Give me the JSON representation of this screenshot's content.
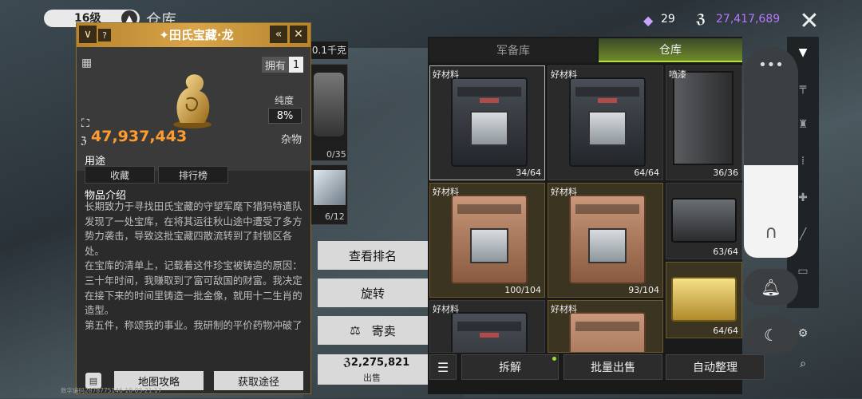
{
  "header": {
    "level": "16级",
    "title": "仓库",
    "gems": "29",
    "money": "27,417,689"
  },
  "detail": {
    "title": "✦田氏宝藏·龙",
    "own_label": "拥有",
    "own_count": "1",
    "purity_label": "纯度",
    "purity_value": "8%",
    "price": "47,937,443",
    "category": "杂物",
    "use_title": "用途",
    "btn_collect": "收藏",
    "btn_rank": "排行榜",
    "intro_title": "物品介绍",
    "description": "长期致力于寻找田氏宝藏的守望军麾下猎犸特遣队发现了一处宝库，在将其运往秋山途中遭受了多方势力袭击，导致这批宝藏四散流转到了封锁区各处。\n在宝库的清单上，记载着这件珍宝被铸造的原因：三十年时间，我赚取到了富可敌国的财富。我决定在接下来的时间里铸造一批金像，就用十二生肖的造型。\n第五件，称颂我的事业。我研制的平价药物冲破了",
    "btn_map": "地图攻略",
    "btn_source": "获取途径",
    "watermark": "数字编码2878775146-10-03-21:17"
  },
  "middle": {
    "weight": "0.1千克",
    "slot1_count": "0/35",
    "slot2_count": "6/12"
  },
  "actions": {
    "view_rank": "查看排名",
    "rotate": "旋转",
    "consign": "寄卖",
    "sell_price": "2,275,821",
    "sell_label": "出售"
  },
  "warehouse": {
    "tabs": [
      "军备库",
      "仓库"
    ],
    "cells": [
      {
        "tag": "好材料",
        "count": "34/64"
      },
      {
        "tag": "好材料",
        "count": "64/64"
      },
      {
        "tag": "喷漆",
        "count": "36/36"
      },
      {
        "tag": "好材料",
        "count": "100/104"
      },
      {
        "tag": "好材料",
        "count": "93/104"
      },
      {
        "tag": "",
        "count": "63/64"
      },
      {
        "tag": "好材料",
        "count": ""
      },
      {
        "tag": "好材料",
        "count": ""
      },
      {
        "tag": "",
        "count": "64/64"
      }
    ],
    "bottom": {
      "disassemble": "拆解",
      "batch_sell": "批量出售",
      "auto_sort": "自动整理"
    }
  }
}
